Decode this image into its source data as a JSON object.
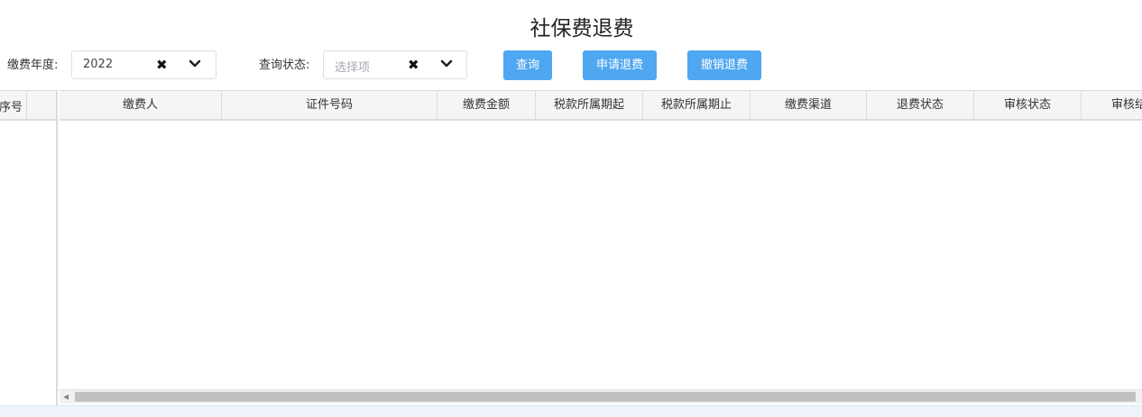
{
  "page": {
    "title": "社保费退费"
  },
  "filters": {
    "year": {
      "label": "缴费年度:",
      "value": "2022"
    },
    "status": {
      "label": "查询状态:",
      "placeholder": "选择项"
    }
  },
  "buttons": {
    "query": "查询",
    "apply_refund": "申请退费",
    "cancel_refund": "撤销退费"
  },
  "table": {
    "fixed_columns": [
      "序号"
    ],
    "columns": [
      "缴费人",
      "证件号码",
      "缴费金额",
      "税款所属期起",
      "税款所属期止",
      "缴费渠道",
      "退费状态",
      "审核状态",
      "审核结果"
    ],
    "rows": []
  },
  "icons": {
    "clear": "close-icon",
    "dropdown": "chevron-down-icon",
    "scroll_left": "scroll-left-arrow-icon"
  },
  "colors": {
    "button": "#4fa7f1",
    "header_bg": "#f5f5f5",
    "border": "#dcdcdc"
  }
}
